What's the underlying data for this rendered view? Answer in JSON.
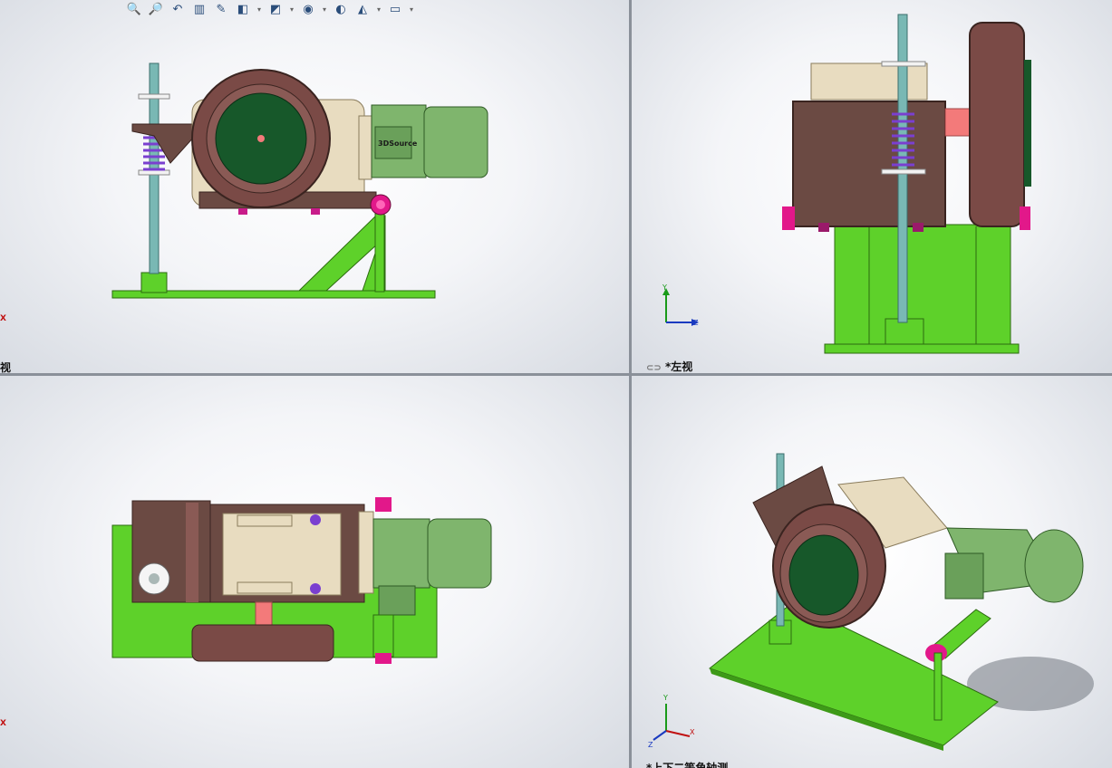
{
  "toolbar": {
    "items": [
      {
        "icon": "zoom-to-fit-icon",
        "glyph": "🔍"
      },
      {
        "icon": "zoom-area-icon",
        "glyph": "🔎"
      },
      {
        "icon": "previous-view-icon",
        "glyph": "↶"
      },
      {
        "icon": "section-view-icon",
        "glyph": "▥"
      },
      {
        "icon": "dynamic-annotation-icon",
        "glyph": "✎"
      },
      {
        "icon": "view-orientation-icon",
        "glyph": "◧"
      },
      {
        "icon": "display-style-icon",
        "glyph": "◩"
      },
      {
        "icon": "hide-show-items-icon",
        "glyph": "◉"
      },
      {
        "icon": "edit-appearance-icon",
        "glyph": "◐"
      },
      {
        "icon": "apply-scene-icon",
        "glyph": "◭"
      },
      {
        "icon": "view-settings-icon",
        "glyph": "▭"
      }
    ]
  },
  "viewports": {
    "top_left": {
      "label": "视"
    },
    "top_right": {
      "label": "*左视"
    },
    "bottom_left": {
      "label": ""
    },
    "bottom_right": {
      "label": "*上下二等角轴测"
    }
  },
  "triad": {
    "x": "X",
    "y": "Y",
    "z": "Z"
  },
  "model": {
    "motor_brand": "3DSource"
  },
  "colors": {
    "base": "#5ed12a",
    "housing": "#6b4a43",
    "wheel": "#7a4a46",
    "motor": "#7fb56d",
    "gearbox": "#e8dcc0",
    "spring": "#7a3fd0",
    "rod": "#79b8b4",
    "accent": "#e2188a"
  }
}
